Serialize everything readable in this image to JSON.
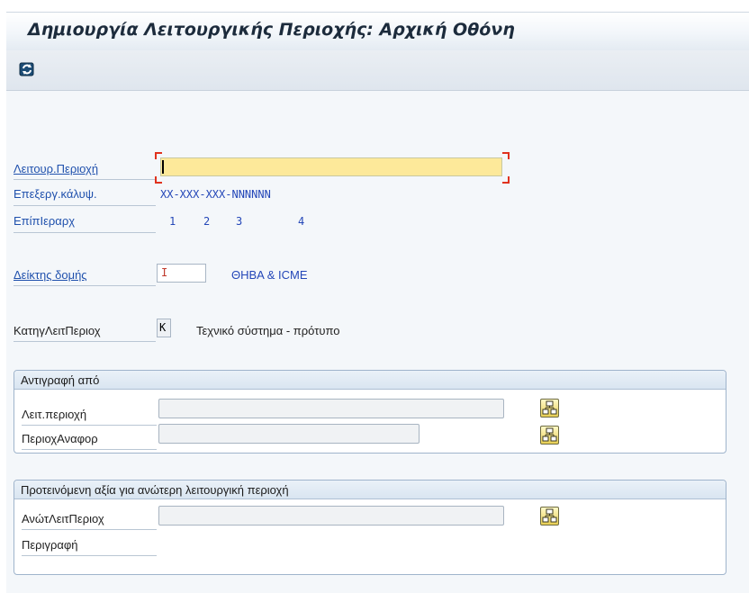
{
  "window": {
    "title": "Δημιουργία Λειτουργικής Περιοχής: Αρχική Οθόνη"
  },
  "toolbar": {
    "refresh_icon": "refresh-icon"
  },
  "form": {
    "functional_location": {
      "label": "Λειτουρ.Περιοχή",
      "value": ""
    },
    "edit_mask": {
      "label": "Επεξεργ.κάλυψ.",
      "value": "XX-XXX-XXX-NNNNNN"
    },
    "hierarchy_levels": {
      "label": "ΕπίπΙεραρχ",
      "levels": [
        "1",
        "2",
        "3",
        "4"
      ]
    },
    "structure_indicator": {
      "label": "Δείκτης δομής",
      "value": "I",
      "description": "ΘΗΒΑ & ICME"
    },
    "fl_category": {
      "label": "ΚατηγΛειτΠεριοχ",
      "value": "K",
      "description": "Τεχνικό σύστημα - πρότυπο"
    }
  },
  "copy_from": {
    "title": "Αντιγραφή από",
    "func_location": {
      "label": "Λειτ.περιοχή",
      "value": ""
    },
    "reference_location": {
      "label": "ΠεριοχΑναφορ",
      "value": ""
    }
  },
  "superior": {
    "title": "Προτεινόμενη αξία για ανώτερη λειτουργική περιοχή",
    "superior_location": {
      "label": "ΑνώτΛειτΠεριοχ",
      "value": ""
    },
    "description": {
      "label": "Περιγραφή",
      "value": ""
    }
  },
  "colors": {
    "accent_blue": "#2051ad",
    "input_yellow": "#fde99a",
    "focus_red": "#e0321e"
  }
}
